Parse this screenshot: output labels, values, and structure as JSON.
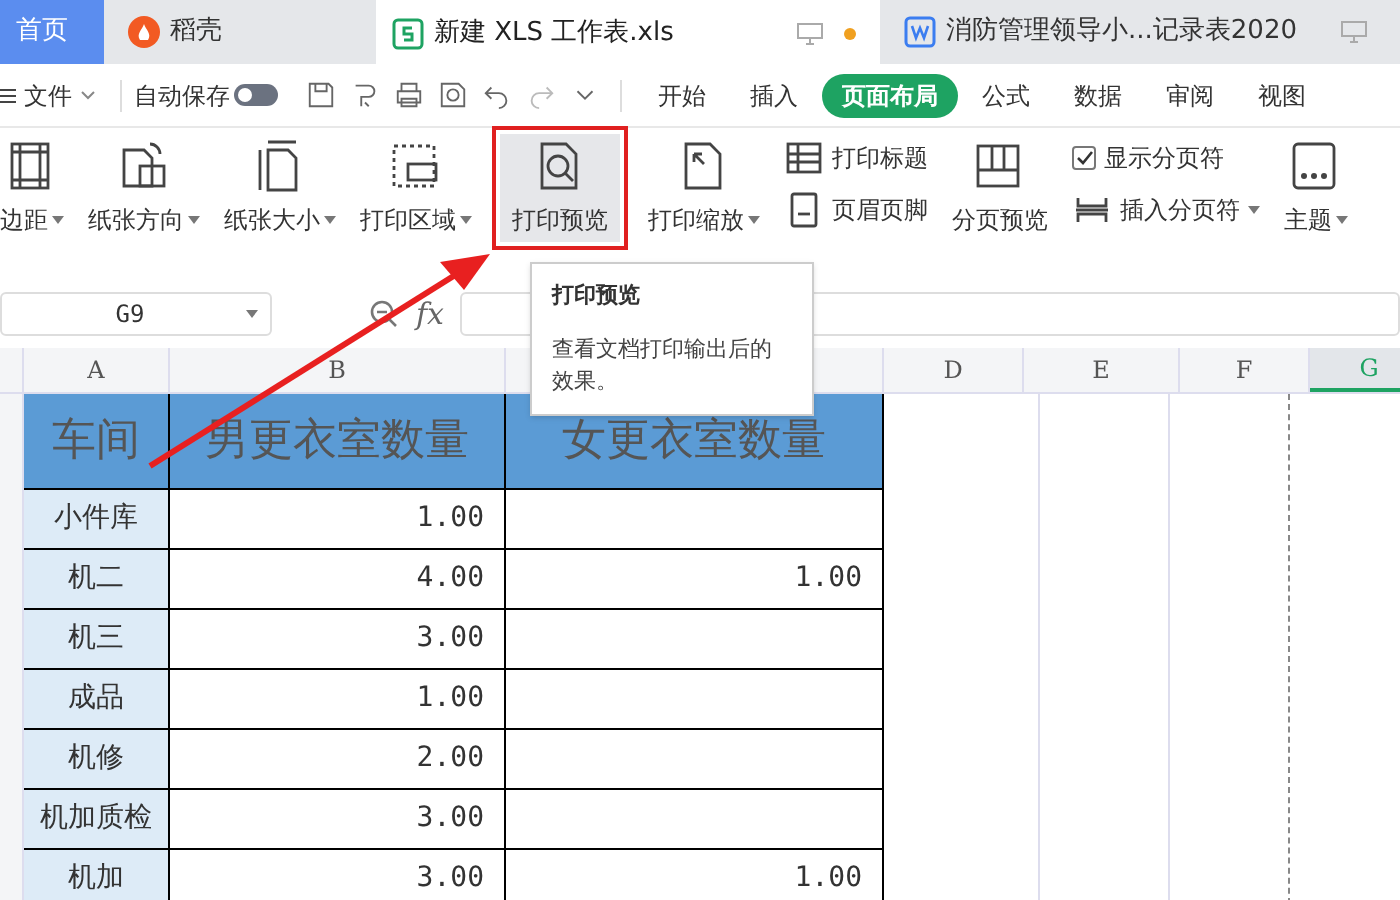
{
  "tabs": [
    {
      "kind": "home",
      "label": "首页",
      "selected": false
    },
    {
      "kind": "docer",
      "label": "稻壳",
      "selected": false
    },
    {
      "kind": "sheet",
      "label": "新建 XLS 工作表.xls",
      "selected": true,
      "unsaved": true
    },
    {
      "kind": "word",
      "label": "消防管理领导小...记录表2020",
      "selected": false,
      "unsaved": false
    }
  ],
  "menu": {
    "file": "文件",
    "autosave": {
      "label": "自动保存",
      "on": false
    },
    "ribbon_tabs": [
      {
        "label": "开始",
        "selected": false
      },
      {
        "label": "插入",
        "selected": false
      },
      {
        "label": "页面布局",
        "selected": true
      },
      {
        "label": "公式",
        "selected": false
      },
      {
        "label": "数据",
        "selected": false
      },
      {
        "label": "审阅",
        "selected": false
      },
      {
        "label": "视图",
        "selected": false
      }
    ]
  },
  "ribbon": [
    {
      "kind": "large",
      "label": "边距",
      "dropdown": true,
      "hovered": false
    },
    {
      "kind": "large",
      "label": "纸张方向",
      "dropdown": true,
      "hovered": false
    },
    {
      "kind": "large",
      "label": "纸张大小",
      "dropdown": true,
      "hovered": false
    },
    {
      "kind": "large",
      "label": "打印区域",
      "dropdown": true,
      "hovered": false
    },
    {
      "kind": "large",
      "label": "打印预览",
      "dropdown": false,
      "hovered": true
    },
    {
      "kind": "large",
      "label": "打印缩放",
      "dropdown": true,
      "hovered": false
    },
    {
      "kind": "stack",
      "items": [
        {
          "kind": "button",
          "label": "打印标题",
          "dropdown": false
        },
        {
          "kind": "button",
          "label": "页眉页脚",
          "dropdown": false
        }
      ]
    },
    {
      "kind": "large",
      "label": "分页预览",
      "dropdown": false,
      "hovered": false
    },
    {
      "kind": "stack",
      "items": [
        {
          "kind": "checkbox",
          "label": "显示分页符",
          "checked": true
        },
        {
          "kind": "button",
          "label": "插入分页符",
          "dropdown": true
        }
      ]
    },
    {
      "kind": "large",
      "label": "主题",
      "dropdown": true,
      "hovered": false
    }
  ],
  "tooltip": {
    "title": "打印预览",
    "text": "查看文档打印输出后的效果。"
  },
  "formula_bar": {
    "name_box": "G9",
    "fx": "fx"
  },
  "columns": [
    {
      "label": "A",
      "selected": false
    },
    {
      "label": "B",
      "selected": false
    },
    {
      "label": "D",
      "selected": false
    },
    {
      "label": "E",
      "selected": false
    },
    {
      "label": "F",
      "selected": false
    },
    {
      "label": "G",
      "selected": true
    }
  ],
  "table": {
    "header": [
      "车间",
      "男更衣室数量",
      "女更衣室数量"
    ],
    "rows": [
      [
        "小件库",
        "1.00",
        ""
      ],
      [
        "机二",
        "4.00",
        "1.00"
      ],
      [
        "机三",
        "3.00",
        ""
      ],
      [
        "成品",
        "1.00",
        ""
      ],
      [
        "机修",
        "2.00",
        ""
      ],
      [
        "机加质检",
        "3.00",
        ""
      ],
      [
        "机加",
        "3.00",
        "1.00"
      ]
    ]
  }
}
